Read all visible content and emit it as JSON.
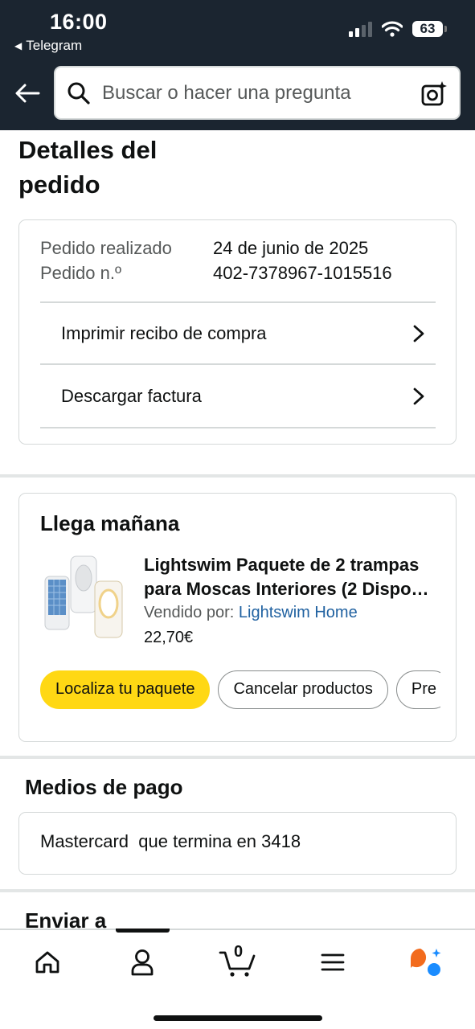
{
  "status_bar": {
    "time": "16:00",
    "back_app": "Telegram",
    "battery": "63"
  },
  "header": {
    "search_placeholder": "Buscar o hacer una pregunta"
  },
  "page": {
    "title": "Detalles del pedido"
  },
  "order": {
    "placed_label": "Pedido realizado",
    "placed_value": "24 de junio de 2025",
    "number_label": "Pedido n.º",
    "number_value": "402-7378967-1015516",
    "links": [
      {
        "label": "Imprimir recibo de compra"
      },
      {
        "label": "Descargar factura"
      }
    ]
  },
  "shipment": {
    "title": "Llega mañana",
    "product_name": "Lightswim Paquete de 2 trampas para Moscas Interiores (2 Dispo…",
    "sold_by_label": "Vendido por:",
    "seller": "Lightswim Home",
    "price": "22,70€",
    "buttons": [
      {
        "label": "Localiza tu paquete"
      },
      {
        "label": "Cancelar productos"
      },
      {
        "label": "Pre"
      }
    ]
  },
  "payment": {
    "title": "Medios de pago",
    "method": "Mastercard  que termina en 3418"
  },
  "ship_to": {
    "title": "Enviar a"
  },
  "nav": {
    "cart_count": "0"
  },
  "colors": {
    "header_bg": "#1b2530",
    "primary_button": "#ffd814",
    "link": "#2162a1"
  }
}
